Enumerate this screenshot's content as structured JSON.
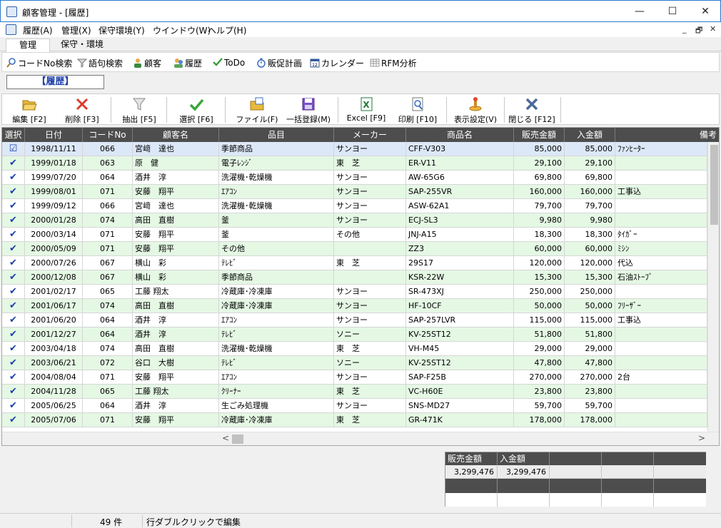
{
  "window": {
    "title": "顧客管理 - [履歴]",
    "minimize": "—",
    "maximize": "☐",
    "close": "✕"
  },
  "menu": {
    "items": [
      "履歴(A)",
      "管理(X)",
      "保守環境(Y)",
      "ウインドウ(W)",
      "ヘルプ(H)"
    ],
    "mdi": [
      "_",
      "🗗",
      "✕"
    ]
  },
  "tabs": [
    "管理",
    "保守・環境"
  ],
  "quickbar": [
    "コードNo検索",
    "語句検索",
    "顧客",
    "履歴",
    "ToDo",
    "販促計画",
    "カレンダー",
    "RFM分析"
  ],
  "section_label": "【履歴】",
  "toolbar": [
    "編集 [F2]",
    "削除 [F3]",
    "抽出 [F5]",
    "選択 [F6]",
    "ファイル(F)",
    "一括登録(M)",
    "Excel [F9]",
    "印刷 [F10]",
    "表示設定(V)",
    "閉じる [F12]"
  ],
  "grid": {
    "headers": [
      "選択",
      "日付",
      "コードNo",
      "顧客名",
      "品目",
      "メーカー",
      "商品名",
      "販売金額",
      "入金額",
      "備考"
    ],
    "rows": [
      [
        "☑",
        "1998/11/11",
        "066",
        "宮﨑　達也",
        "季節商品",
        "サンヨー",
        "CFF-V303",
        "85,000",
        "85,000",
        "ﾌｧﾝﾋｰﾀｰ"
      ],
      [
        "✔",
        "1999/01/18",
        "063",
        "原　健",
        "電子ﾚﾝｼﾞ",
        "東　芝",
        "ER-V11",
        "29,100",
        "29,100",
        ""
      ],
      [
        "✔",
        "1999/07/20",
        "064",
        "酒井　淳",
        "洗濯機･乾燥機",
        "サンヨー",
        "AW-65G6",
        "69,800",
        "69,800",
        ""
      ],
      [
        "✔",
        "1999/08/01",
        "071",
        "安藤　翔平",
        "ｴｱｺﾝ",
        "サンヨー",
        "SAP-255VR",
        "160,000",
        "160,000",
        "工事込"
      ],
      [
        "✔",
        "1999/09/12",
        "066",
        "宮﨑　達也",
        "洗濯機･乾燥機",
        "サンヨー",
        "ASW-62A1",
        "79,700",
        "79,700",
        ""
      ],
      [
        "✔",
        "2000/01/28",
        "074",
        "高田　直樹",
        "釜",
        "サンヨー",
        "ECJ-SL3",
        "9,980",
        "9,980",
        ""
      ],
      [
        "✔",
        "2000/03/14",
        "071",
        "安藤　翔平",
        "釜",
        "その他",
        "JNJ-A15",
        "18,300",
        "18,300",
        "ﾀｲｶﾞｰ"
      ],
      [
        "✔",
        "2000/05/09",
        "071",
        "安藤　翔平",
        "その他",
        "",
        "ZZ3",
        "60,000",
        "60,000",
        "ﾐｼﾝ"
      ],
      [
        "✔",
        "2000/07/26",
        "067",
        "横山　彩",
        "ﾃﾚﾋﾞ",
        "東　芝",
        "29S17",
        "120,000",
        "120,000",
        "代込"
      ],
      [
        "✔",
        "2000/12/08",
        "067",
        "横山　彩",
        "季節商品",
        "",
        "KSR-22W",
        "15,300",
        "15,300",
        "石油ｽﾄｰﾌﾞ"
      ],
      [
        "✔",
        "2001/02/17",
        "065",
        "工藤 翔太",
        "冷蔵庫･冷凍庫",
        "サンヨー",
        "SR-473XJ",
        "250,000",
        "250,000",
        ""
      ],
      [
        "✔",
        "2001/06/17",
        "074",
        "高田　直樹",
        "冷蔵庫･冷凍庫",
        "サンヨー",
        "HF-10CF",
        "50,000",
        "50,000",
        "ﾌﾘｰｻﾞｰ"
      ],
      [
        "✔",
        "2001/06/20",
        "064",
        "酒井　淳",
        "ｴｱｺﾝ",
        "サンヨー",
        "SAP-257LVR",
        "115,000",
        "115,000",
        "工事込"
      ],
      [
        "✔",
        "2001/12/27",
        "064",
        "酒井　淳",
        "ﾃﾚﾋﾞ",
        "ソニー",
        "KV-25ST12",
        "51,800",
        "51,800",
        ""
      ],
      [
        "✔",
        "2003/04/18",
        "074",
        "高田　直樹",
        "洗濯機･乾燥機",
        "東　芝",
        "VH-M45",
        "29,000",
        "29,000",
        ""
      ],
      [
        "✔",
        "2003/06/21",
        "072",
        "谷口　大樹",
        "ﾃﾚﾋﾞ",
        "ソニー",
        "KV-25ST12",
        "47,800",
        "47,800",
        ""
      ],
      [
        "✔",
        "2004/08/04",
        "071",
        "安藤　翔平",
        "ｴｱｺﾝ",
        "サンヨー",
        "SAP-F25B",
        "270,000",
        "270,000",
        "2台"
      ],
      [
        "✔",
        "2004/11/28",
        "065",
        "工藤 翔太",
        "ｸﾘｰﾅｰ",
        "東　芝",
        "VC-H60E",
        "23,800",
        "23,800",
        ""
      ],
      [
        "✔",
        "2005/06/25",
        "064",
        "酒井　淳",
        "生ごみ処理機",
        "サンヨー",
        "SNS-MD27",
        "59,700",
        "59,700",
        ""
      ],
      [
        "✔",
        "2005/07/06",
        "071",
        "安藤　翔平",
        "冷蔵庫･冷凍庫",
        "東　芝",
        "GR-471K",
        "178,000",
        "178,000",
        ""
      ]
    ],
    "selected_row": 0,
    "hscroll_left": "<",
    "hscroll_right": ">"
  },
  "summary": {
    "headers": [
      "販売金額",
      "入金額"
    ],
    "values": [
      "3,299,476",
      "3,299,476"
    ]
  },
  "status": {
    "count": "49 件",
    "hint": "行ダブルクリックで編集"
  },
  "colors": {
    "header_bg": "#4d4d4d",
    "row_alt": "#e4f8e4",
    "row_selected": "#dce8f8",
    "check": "#1a3ea8",
    "label_blue": "#1d3ea8"
  }
}
